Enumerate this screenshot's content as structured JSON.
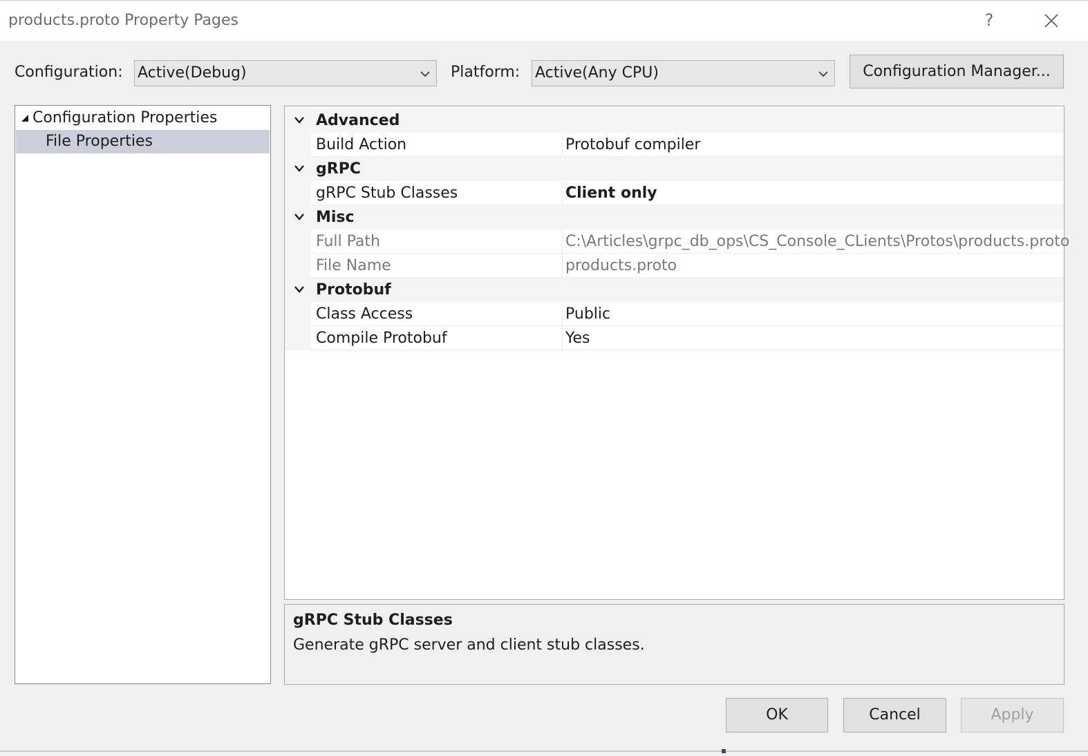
{
  "window": {
    "title": "products.proto Property Pages",
    "help_label": "?"
  },
  "toolbar": {
    "configuration_label": "Configuration:",
    "configuration_value": "Active(Debug)",
    "platform_label": "Platform:",
    "platform_value": "Active(Any CPU)",
    "config_manager_label": "Configuration Manager..."
  },
  "tree": {
    "items": [
      {
        "label": "Configuration Properties",
        "expanded": true
      },
      {
        "label": "File Properties",
        "selected": true
      }
    ]
  },
  "grid": {
    "categories": [
      {
        "name": "Advanced",
        "properties": [
          {
            "name": "Build Action",
            "value": "Protobuf compiler"
          }
        ]
      },
      {
        "name": "gRPC",
        "properties": [
          {
            "name": "gRPC Stub Classes",
            "value": "Client only"
          }
        ]
      },
      {
        "name": "Misc",
        "properties": [
          {
            "name": "Full Path",
            "value": "C:\\Articles\\grpc_db_ops\\CS_Console_CLients\\Protos\\products.proto"
          },
          {
            "name": "File Name",
            "value": "products.proto"
          }
        ]
      },
      {
        "name": "Protobuf",
        "properties": [
          {
            "name": "Class Access",
            "value": "Public"
          },
          {
            "name": "Compile Protobuf",
            "value": "Yes"
          }
        ]
      }
    ]
  },
  "description": {
    "title": "gRPC Stub Classes",
    "text": "Generate gRPC server and client stub classes."
  },
  "buttons": {
    "ok": "OK",
    "cancel": "Cancel",
    "apply": "Apply"
  },
  "colors": {
    "selection": "#cbcedb",
    "category_bg": "#f5f5f5",
    "dialog_bg": "#f0f0f0"
  }
}
